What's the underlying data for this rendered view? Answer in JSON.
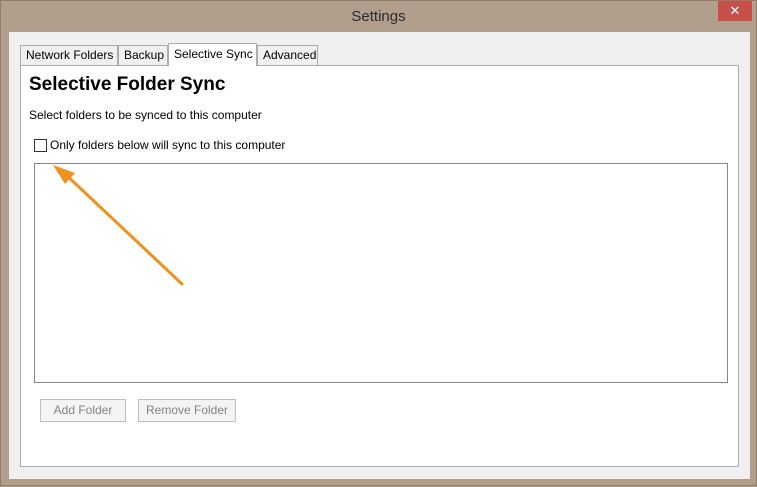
{
  "window": {
    "title": "Settings",
    "close_icon": "close-icon"
  },
  "tabs": [
    {
      "label": "Network Folders",
      "active": false
    },
    {
      "label": "Backup",
      "active": false
    },
    {
      "label": "Selective Sync",
      "active": true
    },
    {
      "label": "Advanced",
      "active": false
    }
  ],
  "panel": {
    "heading": "Selective Folder Sync",
    "description": "Select folders to be synced to this computer",
    "checkbox": {
      "label": "Only folders below will sync to this computer",
      "checked": false
    },
    "folder_list": [],
    "buttons": {
      "add": "Add Folder",
      "remove": "Remove Folder"
    }
  },
  "annotation": {
    "color": "#f0901e"
  }
}
